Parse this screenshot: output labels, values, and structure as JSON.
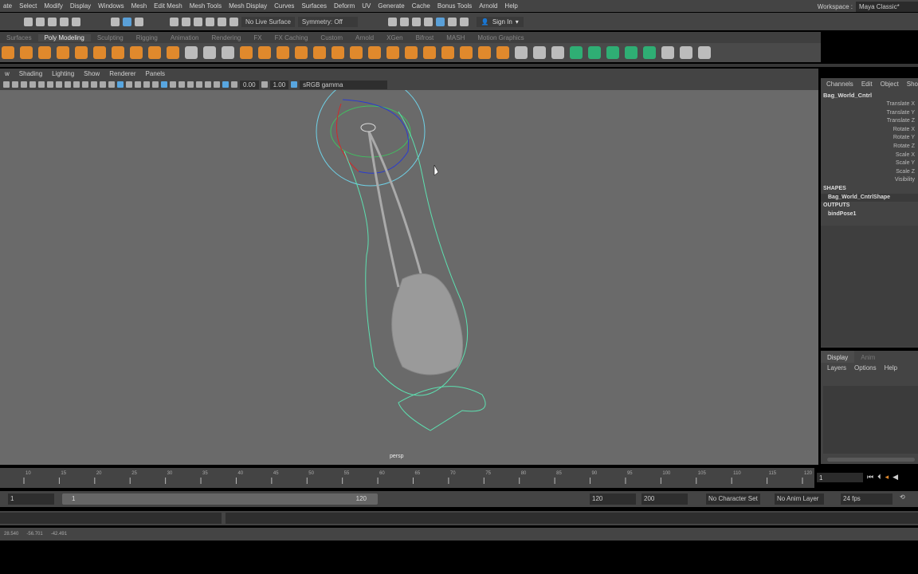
{
  "menubar": {
    "items": [
      "ate",
      "Select",
      "Modify",
      "Display",
      "Windows",
      "Mesh",
      "Edit Mesh",
      "Mesh Tools",
      "Mesh Display",
      "Curves",
      "Surfaces",
      "Deform",
      "UV",
      "Generate",
      "Cache",
      "Bonus Tools",
      "Arnold",
      "Help"
    ]
  },
  "workspace": {
    "label": "Workspace :",
    "value": "Maya Classic*"
  },
  "status": {
    "live_surface": "No Live Surface",
    "symmetry": "Symmetry: Off",
    "sign_in": "Sign In"
  },
  "shelf": {
    "tabs": [
      "Surfaces",
      "Poly Modeling",
      "Sculpting",
      "Rigging",
      "Animation",
      "Rendering",
      "FX",
      "FX Caching",
      "Custom",
      "Arnold",
      "XGen",
      "Bifrost",
      "MASH",
      "Motion Graphics"
    ],
    "active": "Poly Modeling"
  },
  "panel": {
    "menu": [
      "w",
      "Shading",
      "Lighting",
      "Show",
      "Renderer",
      "Panels"
    ],
    "exposure": "0.00",
    "gamma": "1.00",
    "color_space": "sRGB gamma",
    "camera": "persp"
  },
  "channelbox": {
    "menu": [
      "Channels",
      "Edit",
      "Object",
      "Show"
    ],
    "node": "Bag_World_Cntrl",
    "attributes": [
      "Translate X",
      "Translate Y",
      "Translate Z",
      "Rotate X",
      "Rotate Y",
      "Rotate Z",
      "Scale X",
      "Scale Y",
      "Scale Z",
      "Visibility"
    ],
    "shapes_label": "SHAPES",
    "shape": "Bag_World_CntrlShape",
    "outputs_label": "OUTPUTS",
    "output": "bindPose1"
  },
  "layers": {
    "tabs": [
      "Display",
      "Anim"
    ],
    "menu": [
      "Layers",
      "Options",
      "Help"
    ]
  },
  "timeline": {
    "ticks": [
      10,
      15,
      20,
      25,
      30,
      35,
      40,
      45,
      50,
      55,
      60,
      65,
      70,
      75,
      80,
      85,
      90,
      95,
      100,
      105,
      110,
      115,
      120
    ],
    "current_frame": "1"
  },
  "range": {
    "start": "1",
    "inner_start": "1",
    "inner_end": "120",
    "end": "120",
    "anim_end": "200",
    "character_set": "No Character Set",
    "anim_layer": "No Anim Layer",
    "fps": "24 fps"
  },
  "helpline": {
    "values": [
      "28.540",
      "-56.701",
      "-42.491"
    ]
  },
  "colors": {
    "viewport": "#6a6a6a",
    "curve": "#5de0b0",
    "accent": "#e0892c"
  }
}
